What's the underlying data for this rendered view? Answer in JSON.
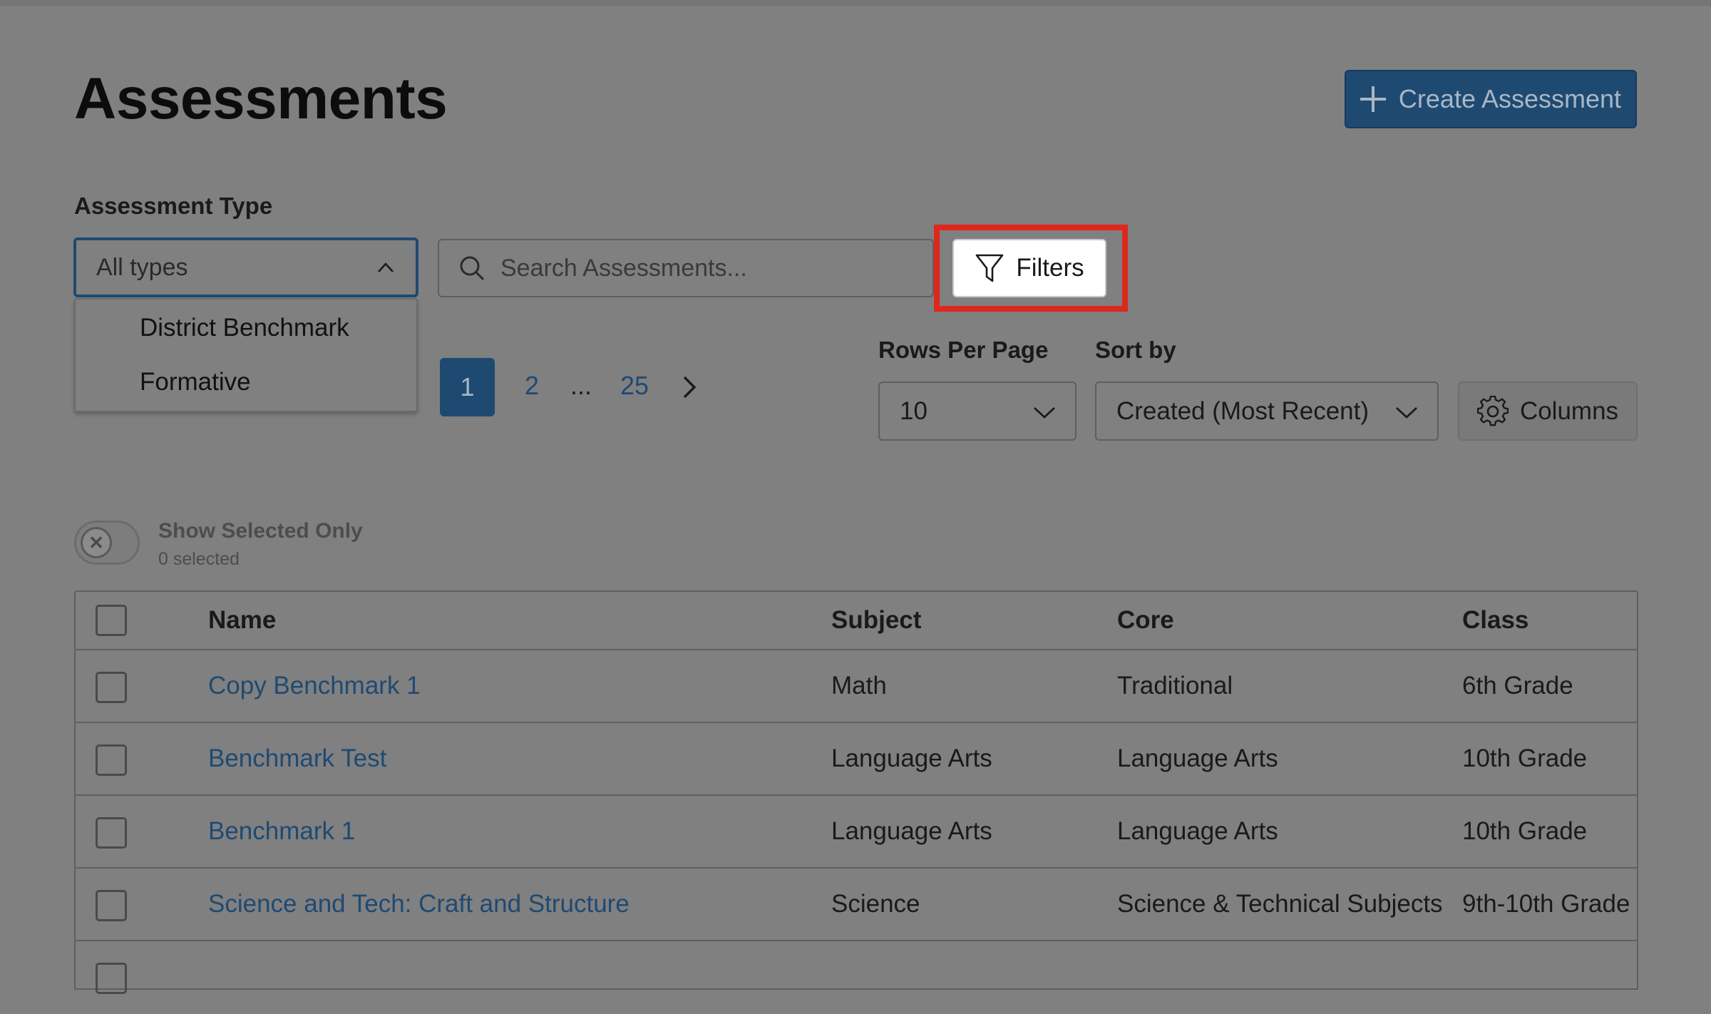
{
  "page": {
    "title": "Assessments",
    "create_button_label": "Create Assessment"
  },
  "filters": {
    "assessment_type_label": "Assessment Type",
    "assessment_type_value": "All types",
    "assessment_type_options": [
      "District Benchmark",
      "Formative"
    ],
    "search_placeholder": "Search Assessments...",
    "filters_button_label": "Filters"
  },
  "pagination": {
    "current_page": "1",
    "page_2": "2",
    "ellipsis": "...",
    "last_page": "25"
  },
  "rows_per_page": {
    "label": "Rows Per Page",
    "value": "10"
  },
  "sort_by": {
    "label": "Sort by",
    "value": "Created (Most Recent)"
  },
  "columns_button_label": "Columns",
  "show_selected": {
    "label": "Show Selected Only",
    "count_text": "0 selected"
  },
  "table": {
    "headers": [
      "Name",
      "Subject",
      "Core",
      "Class"
    ],
    "rows": [
      [
        "Copy Benchmark 1",
        "Math",
        "Traditional",
        "6th Grade"
      ],
      [
        "Benchmark Test",
        "Language Arts",
        "Language Arts",
        "10th Grade"
      ],
      [
        "Benchmark 1",
        "Language Arts",
        "Language Arts",
        "10th Grade"
      ],
      [
        "Science and Tech: Craft and Structure",
        "Science",
        "Science & Technical Subjects",
        "9th-10th Grade"
      ]
    ]
  },
  "colors": {
    "overlay_background": "#808080",
    "primary": "#1e4a72",
    "highlight": "#e0271c"
  },
  "icons": [
    "plus-icon",
    "chevron-up-icon",
    "search-icon",
    "filter-icon",
    "chevron-right-icon",
    "chevron-down-icon",
    "gear-icon",
    "close-icon"
  ]
}
